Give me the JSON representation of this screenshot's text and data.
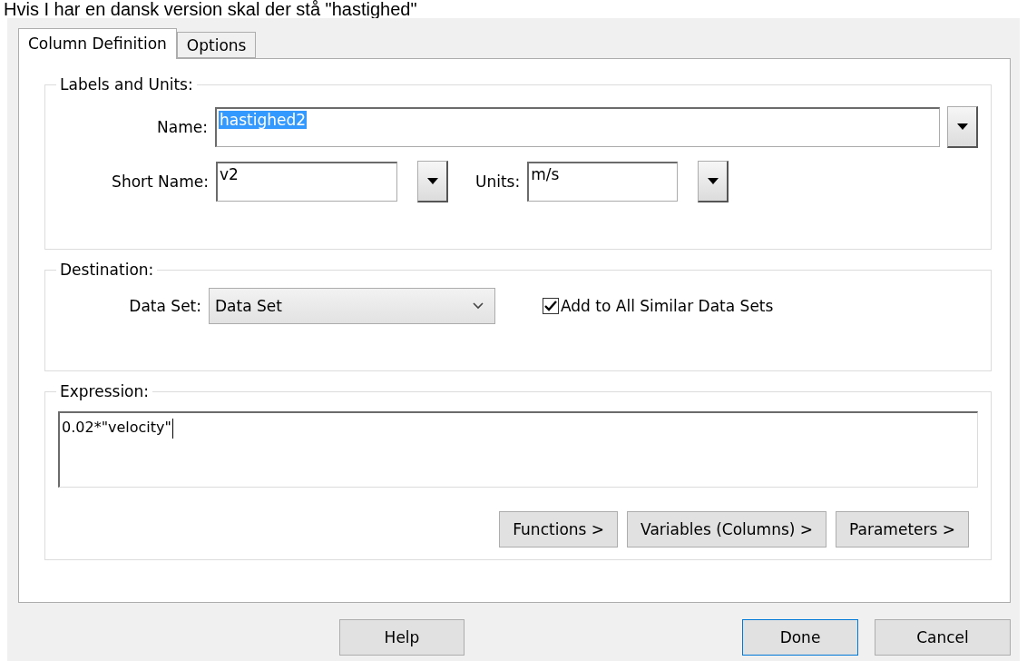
{
  "caption": "Hvis I har en dansk version skal der stå \"hastighed\"",
  "tabs": [
    {
      "label": "Column Definition",
      "selected": true
    },
    {
      "label": "Options",
      "selected": false
    }
  ],
  "labels_and_units": {
    "title": "Labels and Units:",
    "name": {
      "label": "Name:",
      "value": "hastighed2",
      "highlighted": true
    },
    "short_name": {
      "label": "Short Name:",
      "value": "v2"
    },
    "units": {
      "label": "Units:",
      "value": "m/s"
    }
  },
  "destination": {
    "title": "Destination:",
    "data_set": {
      "label": "Data Set:",
      "value": "Data Set"
    },
    "add_to_all": {
      "label": "Add to All Similar Data Sets",
      "checked": true
    }
  },
  "expression": {
    "title": "Expression:",
    "value": "0.02*\"velocity\"",
    "buttons": [
      "Functions >",
      "Variables (Columns) >",
      "Parameters >"
    ]
  },
  "buttons": [
    {
      "label": "Help",
      "default": false
    },
    {
      "label": "Done",
      "default": true
    },
    {
      "label": "Cancel",
      "default": false
    }
  ]
}
